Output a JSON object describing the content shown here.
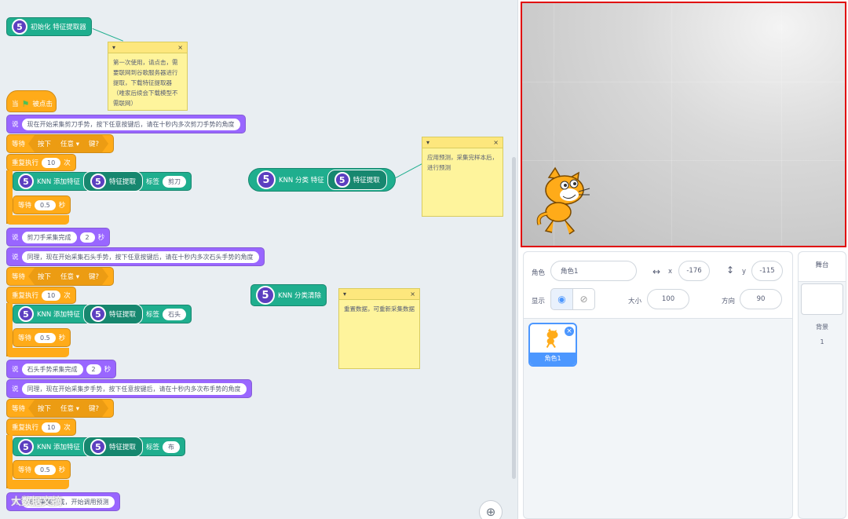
{
  "blocks": {
    "init": {
      "num": "5",
      "label": "初始化 特征提取器"
    },
    "hat": {
      "label1": "当",
      "label2": "被点击"
    },
    "say1": {
      "verb": "说",
      "text": "现在开始采集剪刀手势，按下任意按键后，请在十秒内多次剪刀手势的角度"
    },
    "wait_key": {
      "verb": "等待",
      "key_prefix": "按下",
      "key": "任意",
      "key_suffix": "键?"
    },
    "repeat": {
      "verb": "重复执行",
      "count": "10",
      "unit": "次"
    },
    "knn_add": {
      "num": "5",
      "label": "KNN 添加特征",
      "feat": "特征提取",
      "tag_label": "标签"
    },
    "wait_sec": {
      "verb": "等待",
      "value": "0.5",
      "unit": "秒"
    },
    "tags": [
      "剪刀",
      "石头",
      "布"
    ],
    "say_done1": {
      "verb": "说",
      "text": "剪刀手采集完成",
      "secs": "2",
      "unit": "秒"
    },
    "say2": {
      "verb": "说",
      "text": "同理，现在开始采集石头手势，按下任意按键后，请在十秒内多次石头手势的角度"
    },
    "say_done2": {
      "verb": "说",
      "text": "石头手势采集完成",
      "secs": "2",
      "unit": "秒"
    },
    "say3": {
      "verb": "说",
      "text": "同理，现在开始采集步手势，按下任意按键后，请在十秒内多次布手势的角度"
    },
    "say_last": {
      "verb": "说",
      "text": "所有采集完成，开始调用预测"
    },
    "knn_classify": {
      "num": "5",
      "label": "KNN 分类 特征",
      "feat": "特征提取"
    },
    "knn_clear": {
      "num": "5",
      "label": "KNN 分类清除"
    }
  },
  "notes": [
    {
      "arrow": "▾",
      "close": "×",
      "text": "第一次使用，请点击，需要联网到谷歌服务器进行提取，下载特征提取器（唯家后续会下载模型不需联网）"
    },
    {
      "arrow": "▾",
      "close": "×",
      "text": "应用预测，采集完样本后，进行预测"
    },
    {
      "arrow": "▾",
      "close": "×",
      "text": "重置数据，可重新采集数据"
    }
  ],
  "sprite_info": {
    "sprite_label": "角色",
    "sprite_name": "角色1",
    "x_label": "x",
    "x_value": "-176",
    "y_label": "y",
    "y_value": "-115",
    "show_label": "显示",
    "size_label": "大小",
    "size_value": "100",
    "direction_label": "方向",
    "direction_value": "90"
  },
  "sprite_list": [
    {
      "name": "角色1"
    }
  ],
  "stage_pane": {
    "title": "舞台",
    "backdrop_label": "背景",
    "backdrop_count": "1"
  },
  "zoom": {
    "icon": "⊕"
  },
  "watermark": "大数据文摘"
}
